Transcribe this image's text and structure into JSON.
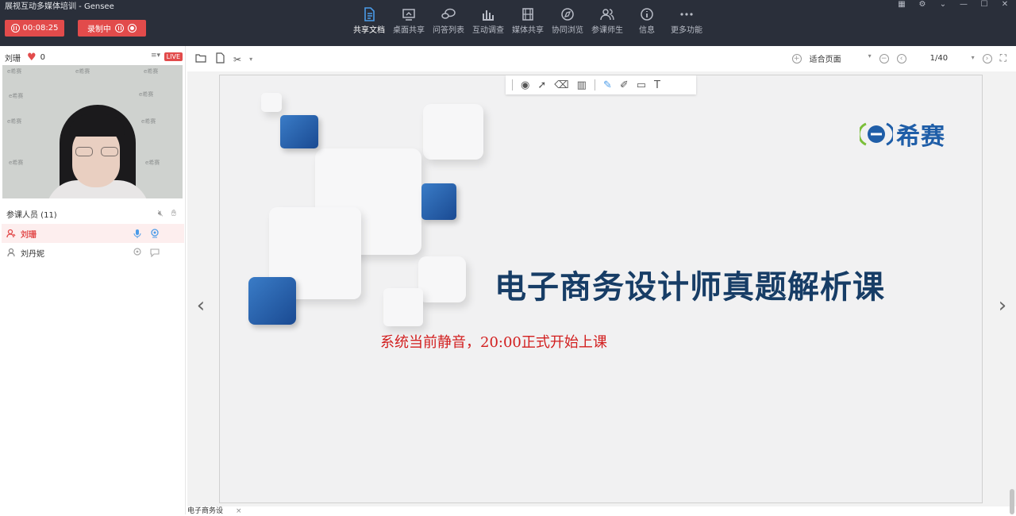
{
  "app": {
    "title": "展视互动多媒体培训  - Gensee",
    "timer": "00:08:25",
    "record_label": "录制中"
  },
  "nav": [
    {
      "label": "共享文档",
      "icon": "document-icon",
      "active": true
    },
    {
      "label": "桌面共享",
      "icon": "desktop-icon"
    },
    {
      "label": "问答列表",
      "icon": "qa-icon"
    },
    {
      "label": "互动调查",
      "icon": "survey-chart-icon"
    },
    {
      "label": "媒体共享",
      "icon": "media-film-icon"
    },
    {
      "label": "协同浏览",
      "icon": "compass-icon"
    },
    {
      "label": "参课师生",
      "icon": "people-icon"
    },
    {
      "label": "信息",
      "icon": "info-icon"
    },
    {
      "label": "更多功能",
      "icon": "more-icon"
    }
  ],
  "presenter": {
    "name": "刘珊",
    "likes": "0",
    "live_badge": "LIVE",
    "wall_text": "e希赛"
  },
  "participants": {
    "header": "参课人员 (11)",
    "list": [
      {
        "name": "刘珊",
        "role": "host"
      },
      {
        "name": "刘丹妮",
        "role": "attendee"
      }
    ]
  },
  "doc_toolbar": {
    "zoom": "适合页面",
    "page": "1/40"
  },
  "slide": {
    "logo_text": "希赛",
    "title": "电子商务设计师真题解析课",
    "notice": "系统当前静音，20:00正式开始上课"
  },
  "doc_tab": {
    "label": "电子商务设",
    "close": "×"
  },
  "colors": {
    "topbar": "#2a2f3a",
    "accent_red": "#e24b4b",
    "title_navy": "#173d66",
    "notice_red": "#d21f1f",
    "brand_blue": "#1f5ea8"
  }
}
